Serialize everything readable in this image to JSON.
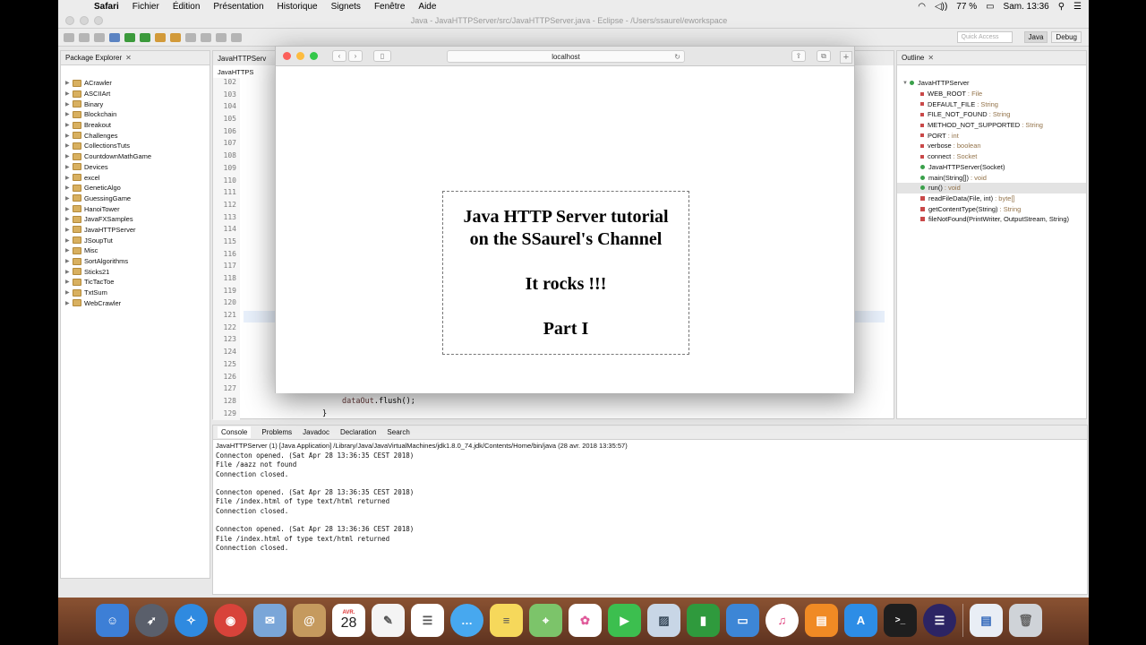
{
  "menubar": {
    "app": "Safari",
    "items": [
      "Fichier",
      "Édition",
      "Présentation",
      "Historique",
      "Signets",
      "Fenêtre",
      "Aide"
    ],
    "battery": "77 %",
    "clock": "Sam. 13:36"
  },
  "eclipse": {
    "title": "Java - JavaHTTPServer/src/JavaHTTPServer.java - Eclipse - /Users/ssaurel/eworkspace",
    "quick_access": "Quick Access",
    "perspectives": [
      "Java",
      "Debug"
    ]
  },
  "package_explorer": {
    "title": "Package Explorer",
    "projects": [
      "ACrawler",
      "ASCIIArt",
      "Binary",
      "Blockchain",
      "Breakout",
      "Challenges",
      "CollectionsTuts",
      "CountdownMathGame",
      "Devices",
      "excel",
      "GeneticAlgo",
      "GuessingGame",
      "HanoiTower",
      "JavaFXSamples",
      "JavaHTTPServer",
      "JSoupTut",
      "Misc",
      "SortAlgorithms",
      "Sticks21",
      "TicTacToe",
      "TxtSum",
      "WebCrawler"
    ]
  },
  "editor": {
    "tab": "JavaHTTPServ",
    "breadcrumb": "JavaHTTPS",
    "line_numbers": [
      "102",
      "103",
      "104",
      "105",
      "106",
      "107",
      "108",
      "109",
      "110",
      "111",
      "112",
      "113",
      "114",
      "115",
      "116",
      "117",
      "118",
      "119",
      "120",
      "121",
      "122",
      "123",
      "124",
      "125",
      "126",
      "127",
      "128",
      "129"
    ],
    "code_flush_var": "dataOut",
    "code_flush_call": ".flush();",
    "code_brace": "}"
  },
  "outline": {
    "title": "Outline",
    "root": "JavaHTTPServer",
    "members": [
      {
        "name": "WEB_ROOT",
        "type": " : File"
      },
      {
        "name": "DEFAULT_FILE",
        "type": " : String"
      },
      {
        "name": "FILE_NOT_FOUND",
        "type": " : String"
      },
      {
        "name": "METHOD_NOT_SUPPORTED",
        "type": " : String"
      },
      {
        "name": "PORT",
        "type": " : int"
      },
      {
        "name": "verbose",
        "type": " : boolean"
      },
      {
        "name": "connect",
        "type": " : Socket"
      },
      {
        "name": "JavaHTTPServer(Socket)",
        "type": ""
      },
      {
        "name": "main(String[])",
        "type": " : void"
      },
      {
        "name": "run()",
        "type": " : void"
      },
      {
        "name": "readFileData(File, int)",
        "type": " : byte[]"
      },
      {
        "name": "getContentType(String)",
        "type": " : String"
      },
      {
        "name": "fileNotFound(PrintWriter, OutputStream, String)",
        "type": ""
      }
    ]
  },
  "console": {
    "tabs": [
      "Console",
      "Problems",
      "Javadoc",
      "Declaration",
      "Search"
    ],
    "description": "JavaHTTPServer (1) [Java Application] /Library/Java/JavaVirtualMachines/jdk1.8.0_74.jdk/Contents/Home/bin/java (28 avr. 2018 13:35:57)",
    "lines": [
      "Connecton opened. (Sat Apr 28 13:36:35 CEST 2018)",
      "File /aazz not found",
      "Connection closed.",
      "",
      "Connecton opened. (Sat Apr 28 13:36:35 CEST 2018)",
      "File /index.html of type text/html returned",
      "Connection closed.",
      "",
      "Connecton opened. (Sat Apr 28 13:36:36 CEST 2018)",
      "File /index.html of type text/html returned",
      "Connection closed."
    ]
  },
  "safari": {
    "url": "localhost",
    "page": {
      "line1": "Java HTTP Server tutorial",
      "line2": "on the SSaurel's Channel",
      "line3": "It rocks !!!",
      "line4": "Part I"
    }
  },
  "dock": {
    "calendar_month": "AVR.",
    "calendar_day": "28",
    "apps": [
      "Finder",
      "Launchpad",
      "Safari",
      "Chrome",
      "Mail",
      "Contacts",
      "Calendar",
      "TextEdit",
      "Reminders",
      "Messages",
      "Notes",
      "Maps",
      "Photos",
      "FaceTime",
      "Preview",
      "Numbers",
      "Keynote",
      "iTunes",
      "iBooks",
      "App Store",
      "Terminal",
      "Eclipse",
      "Downloads",
      "Trash"
    ]
  }
}
